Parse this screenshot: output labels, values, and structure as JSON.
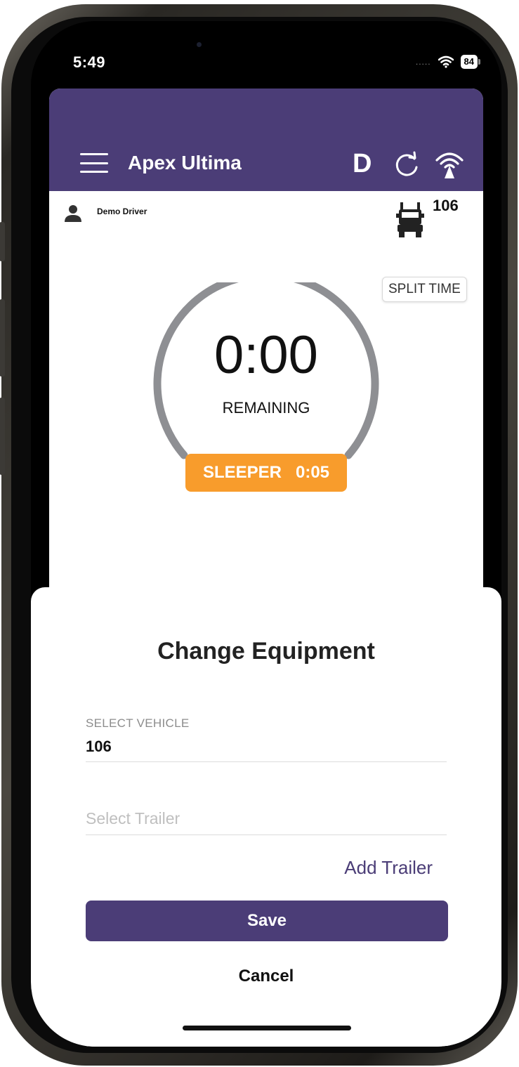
{
  "status_bar": {
    "time": "5:49",
    "signal": ".....",
    "battery": "84"
  },
  "app": {
    "title": "Apex Ultima",
    "duty_icon_letter": "D",
    "driver_name": "Demo Driver",
    "vehicle_number": "106",
    "split_time_label": "SPLIT TIME",
    "timer": {
      "value": "0:00",
      "label": "REMAINING"
    },
    "status": {
      "label": "SLEEPER",
      "time": "0:05",
      "color": "#f89c2c"
    }
  },
  "sheet": {
    "title": "Change Equipment",
    "vehicle_field": {
      "label": "SELECT VEHICLE",
      "value": "106"
    },
    "trailer_field": {
      "placeholder": "Select Trailer"
    },
    "add_trailer_label": "Add Trailer",
    "save_label": "Save",
    "cancel_label": "Cancel"
  },
  "colors": {
    "brand": "#4b3d77",
    "sleeper": "#f89c2c"
  },
  "icons": [
    "menu-icon",
    "duty-status-icon",
    "refresh-icon",
    "wifi-icon",
    "driver-icon",
    "truck-icon",
    "signal-dots-icon",
    "wifi-status-icon",
    "battery-icon"
  ]
}
